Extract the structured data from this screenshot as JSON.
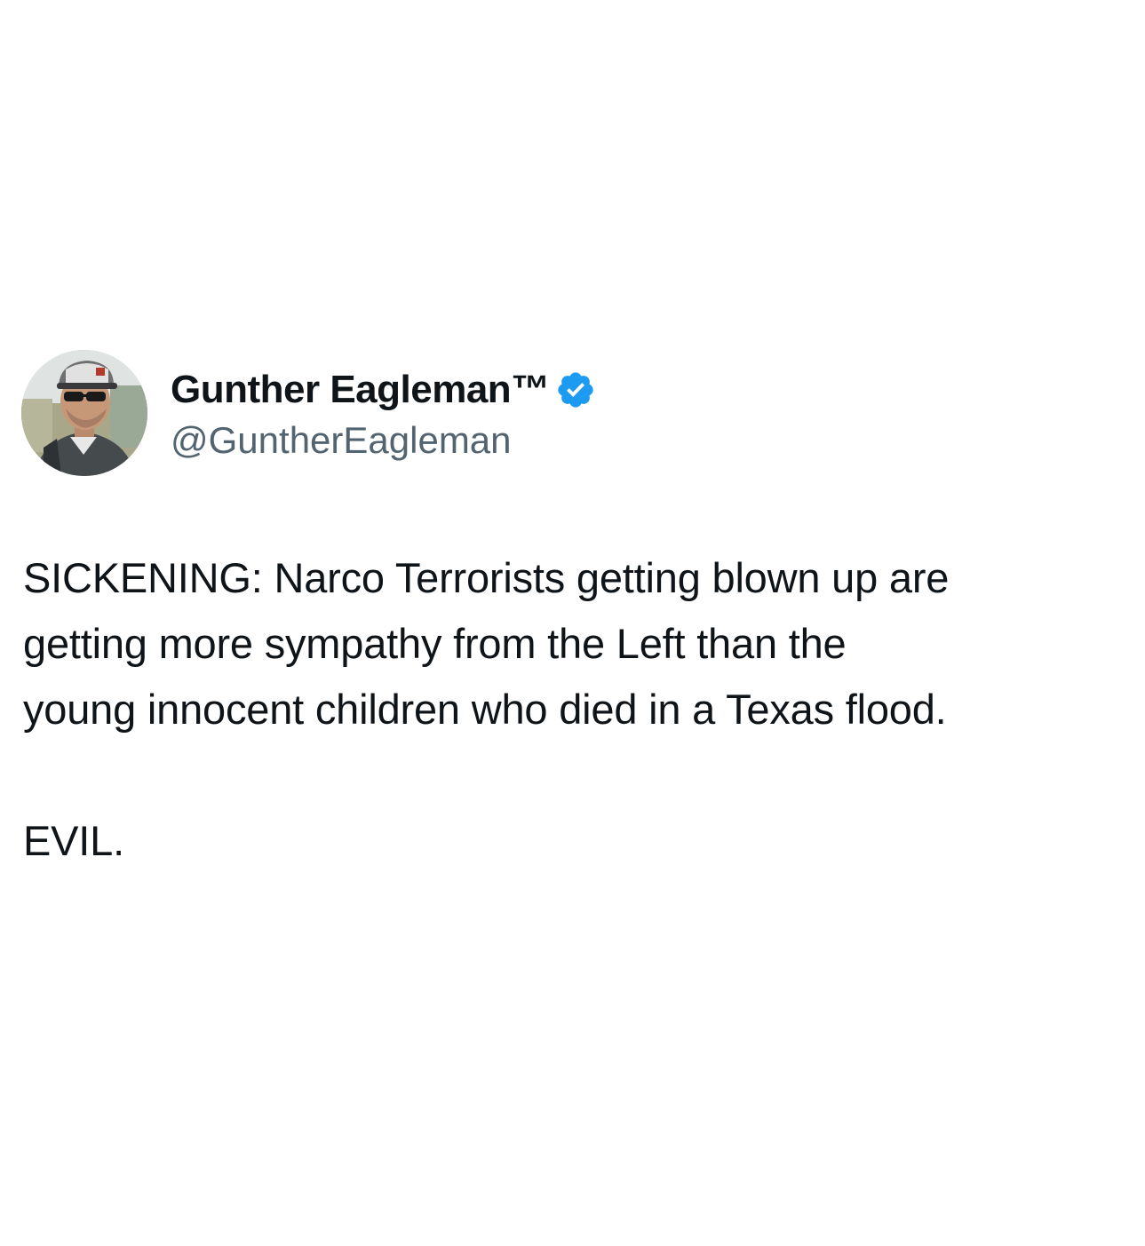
{
  "author": {
    "display_name": "Gunther Eagleman™",
    "handle": "@GuntherEagleman",
    "verified": true,
    "verified_icon": "verified-badge-icon",
    "verified_color": "#1d9bf0"
  },
  "tweet": {
    "lines": [
      "SICKENING:  Narco Terrorists getting blown up are",
      "getting more sympathy from the Left than the",
      "young innocent children who died in a Texas flood."
    ],
    "closing": "EVIL."
  },
  "colors": {
    "text": "#0f1419",
    "secondary_text": "#536471",
    "background": "#ffffff"
  }
}
